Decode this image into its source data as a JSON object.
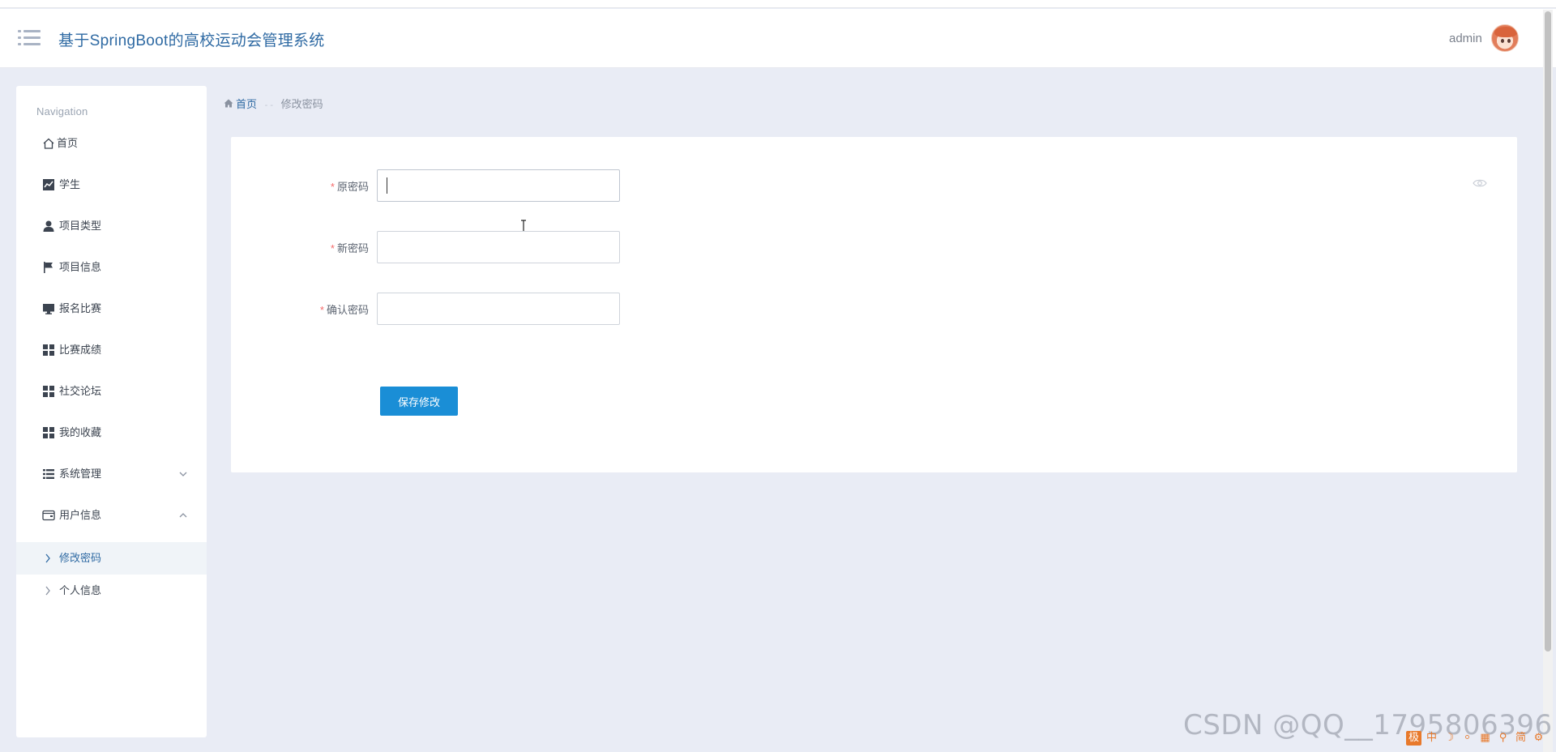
{
  "header": {
    "title": "基于SpringBoot的高校运动会管理系统",
    "username": "admin"
  },
  "sidebar": {
    "heading": "Navigation",
    "items": [
      {
        "label": "首页",
        "icon": "home-icon"
      },
      {
        "label": "学生",
        "icon": "line-chart-icon"
      },
      {
        "label": "项目类型",
        "icon": "user-icon"
      },
      {
        "label": "项目信息",
        "icon": "flag-icon"
      },
      {
        "label": "报名比赛",
        "icon": "monitor-icon"
      },
      {
        "label": "比赛成绩",
        "icon": "grid-icon"
      },
      {
        "label": "社交论坛",
        "icon": "grid-icon"
      },
      {
        "label": "我的收藏",
        "icon": "grid-icon"
      },
      {
        "label": "系统管理",
        "icon": "list-icon"
      },
      {
        "label": "用户信息",
        "icon": "wallet-icon"
      }
    ],
    "sub_items": [
      {
        "label": "修改密码",
        "active": true
      },
      {
        "label": "个人信息",
        "active": false
      }
    ]
  },
  "breadcrumb": {
    "home": "首页",
    "separator": "- -",
    "current": "修改密码"
  },
  "form": {
    "required_mark": "*",
    "fields": [
      {
        "label": "原密码",
        "value": "",
        "focused": true
      },
      {
        "label": "新密码",
        "value": ""
      },
      {
        "label": "确认密码",
        "value": ""
      }
    ],
    "submit_label": "保存修改"
  },
  "watermark": "CSDN @QQ__1795806396",
  "ime": [
    "极",
    "中",
    "☽",
    "⸰",
    "▦",
    "⚲",
    "简",
    "⚙"
  ],
  "colors": {
    "accent": "#1a8ed6",
    "title": "#2f6aa3",
    "required": "#f56c6c",
    "background": "#e9ecf5"
  }
}
